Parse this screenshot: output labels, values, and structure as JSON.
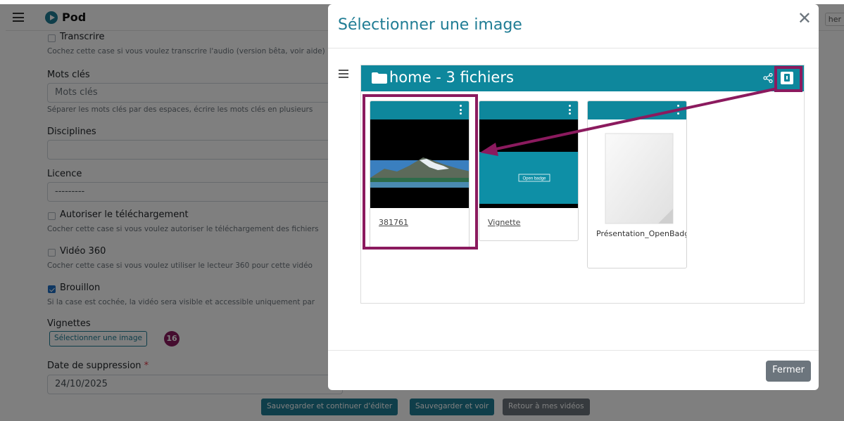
{
  "app": {
    "title": "Pod",
    "topbar_right": "her"
  },
  "form": {
    "transcribe_label": "Transcrire",
    "transcribe_help": "Cochez cette case si vous voulez transcrire l'audio (version bêta, voir aide)",
    "keywords_label": "Mots clés",
    "keywords_placeholder": "Mots clés",
    "keywords_help": "Séparer les mots clés par des espaces, écrire les mots clés en plusieurs",
    "disciplines_label": "Disciplines",
    "license_label": "Licence",
    "license_value": "---------",
    "download_label": "Autoriser le téléchargement",
    "download_help": "Cocher cette case si vous voulez autoriser le téléchargement des fichiers",
    "video360_label": "Vidéo 360",
    "video360_help": "Cocher cette case si vous voulez utiliser le lecteur 360 pour cette vidéo",
    "draft_label": "Brouillon",
    "draft_help": "Si la case est cochée, la vidéo sera visible et accessible uniquement par",
    "thumbnails_label": "Vignettes",
    "select_image_button": "Sélectionner une image",
    "step_badge": "16",
    "deletion_date_label": "Date de suppression",
    "deletion_date_required": "*",
    "deletion_date_value": "24/10/2025",
    "save_continue": "Sauvegarder et continuer d'éditer",
    "save_view": "Sauvegarder et voir",
    "back_videos": "Retour à mes vidéos"
  },
  "modal": {
    "title": "Sélectionner une image",
    "close_icon": "close-icon",
    "close_button": "Fermer",
    "filemanager": {
      "title": "home - 3 fichiers",
      "files": [
        {
          "name": "381761",
          "thumb": "landscape"
        },
        {
          "name": "Vignette",
          "thumb": "open-badge",
          "thumb_text": "Open badge"
        },
        {
          "name": "Présentation_OpenBadg",
          "thumb": "document"
        }
      ]
    }
  },
  "colors": {
    "accent": "#0e879c",
    "annotation": "#8b1a5e",
    "title": "#1f7c94"
  }
}
